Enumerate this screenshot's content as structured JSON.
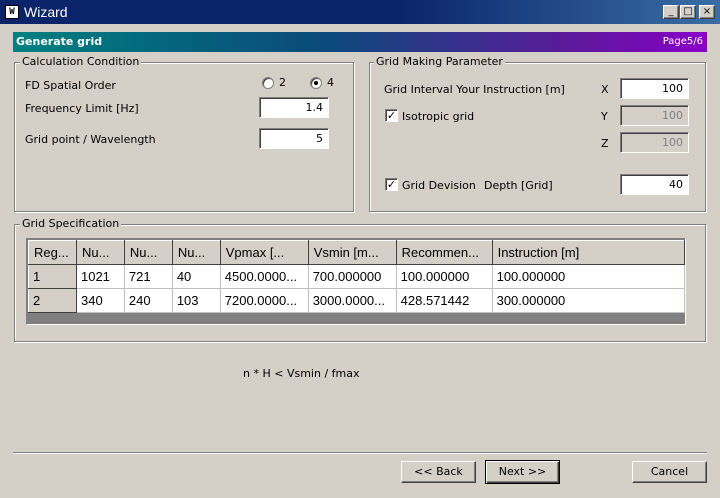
{
  "window": {
    "title": "Wizard",
    "app_icon_text": "W",
    "minimize_glyph": "_",
    "maximize_glyph": "□",
    "close_glyph": "×"
  },
  "header": {
    "title": "Generate grid",
    "page": "Page5/6"
  },
  "calculation_condition": {
    "legend": "Calculation Condition",
    "fd_spatial_order_label": "FD Spatial Order",
    "order_options": [
      {
        "label": "2",
        "selected": false
      },
      {
        "label": "4",
        "selected": true
      }
    ],
    "frequency_limit_label": "Frequency Limit [Hz]",
    "frequency_limit_value": "1.4",
    "grid_point_label": "Grid point / Wavelength",
    "grid_point_value": "5"
  },
  "grid_making_parameter": {
    "legend": "Grid Making Parameter",
    "interval_label": "Grid Interval Your Instruction [m]",
    "x_label": "X",
    "x_value": "100",
    "isotropic_label": "Isotropic grid",
    "isotropic_checked": true,
    "y_label": "Y",
    "y_value": "100",
    "z_label": "Z",
    "z_value": "100",
    "division_label": "Grid Devision",
    "division_checked": true,
    "depth_label": "Depth [Grid]",
    "depth_value": "40",
    "check_glyph": "✓"
  },
  "grid_specification": {
    "legend": "Grid Specification",
    "columns": [
      "Reg...",
      "Nu...",
      "Nu...",
      "Nu...",
      "Vpmax [...",
      "Vsmin [m...",
      "Recommen...",
      "Instruction [m]"
    ],
    "rows": [
      [
        "1",
        "1021",
        "721",
        "40",
        "4500.0000...",
        "700.000000",
        "100.000000",
        "100.000000"
      ],
      [
        "2",
        "340",
        "240",
        "103",
        "7200.0000...",
        "3000.0000...",
        "428.571442",
        "300.000000"
      ]
    ]
  },
  "formula": "n * H < Vsmin / fmax",
  "buttons": {
    "back": "<< Back",
    "next": "Next >>",
    "cancel": "Cancel"
  },
  "colors": {
    "titlebar": "#0a246a",
    "header_gradient_start": "#008080",
    "header_gradient_end": "#8a00c8",
    "face": "#d4d0c8"
  }
}
